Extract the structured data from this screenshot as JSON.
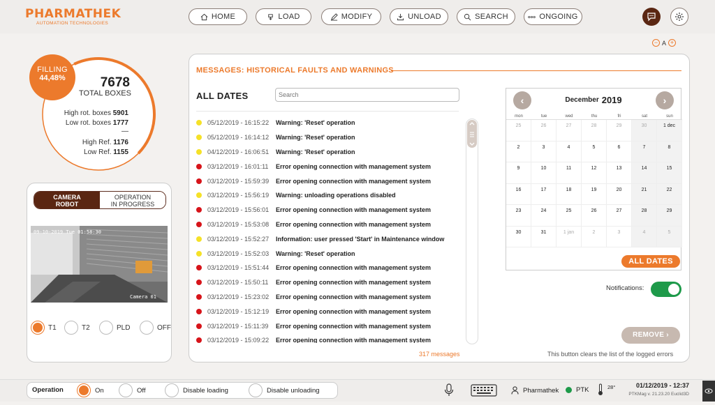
{
  "brand": {
    "name": "PHARMATHEK",
    "tagline": "AUTOMATION TECHNOLOGIES"
  },
  "nav": [
    {
      "label": "HOME",
      "icon": "home-icon"
    },
    {
      "label": "LOAD",
      "icon": "load-icon"
    },
    {
      "label": "MODIFY",
      "icon": "edit-icon"
    },
    {
      "label": "UNLOAD",
      "icon": "download-icon"
    },
    {
      "label": "SEARCH",
      "icon": "search-icon"
    },
    {
      "label": "ONGOING",
      "icon": "dots-icon"
    }
  ],
  "zoom": {
    "minus": "−",
    "label": "A",
    "plus": "+"
  },
  "filling": {
    "label": "FILLING",
    "value": "44,48%",
    "progress": 0.4448
  },
  "boxes": {
    "total": "7678",
    "total_label": "TOTAL BOXES",
    "high_rot_label": "High rot. boxes",
    "high_rot": "5901",
    "low_rot_label": "Low rot. boxes",
    "low_rot": "1777",
    "dash": "—",
    "high_ref_label": "High Ref.",
    "high_ref": "1176",
    "low_ref_label": "Low Ref.",
    "low_ref": "1155"
  },
  "camera_tabs": {
    "active_1": "CAMERA",
    "active_2": "ROBOT",
    "inactive_1": "OPERATION",
    "inactive_2": "IN PROGRESS"
  },
  "camera": {
    "timestamp": "09-10-2019 Tue 01:58:30",
    "label": "Camera 01"
  },
  "camera_options": [
    {
      "label": "T1",
      "selected": true
    },
    {
      "label": "T2",
      "selected": false
    },
    {
      "label": "PLD",
      "selected": false
    },
    {
      "label": "OFF",
      "selected": false
    }
  ],
  "messages": {
    "title": "MESSAGES: HISTORICAL FAULTS AND WARNINGS",
    "filter_label": "ALL DATES",
    "search_placeholder": "Search",
    "count": "317 messages",
    "clear_info": "This button clears the list of the logged errors",
    "items": [
      {
        "level": "warning",
        "datetime": "05/12/2019 - 16:15:22",
        "text": "Warning: 'Reset' operation"
      },
      {
        "level": "warning",
        "datetime": "05/12/2019 - 16:14:12",
        "text": "Warning: 'Reset' operation"
      },
      {
        "level": "warning",
        "datetime": "04/12/2019 - 16:06:51",
        "text": "Warning: 'Reset' operation"
      },
      {
        "level": "error",
        "datetime": "03/12/2019 - 16:01:11",
        "text": "Error opening connection with management system"
      },
      {
        "level": "error",
        "datetime": "03/12/2019 - 15:59:39",
        "text": "Error opening connection with management system"
      },
      {
        "level": "warning",
        "datetime": "03/12/2019 - 15:56:19",
        "text": "Warning: unloading operations disabled"
      },
      {
        "level": "error",
        "datetime": "03/12/2019 - 15:56:01",
        "text": "Error opening connection with management system"
      },
      {
        "level": "error",
        "datetime": "03/12/2019 - 15:53:08",
        "text": "Error opening connection with management system"
      },
      {
        "level": "warning",
        "datetime": "03/12/2019 - 15:52:27",
        "text": "Information: user pressed 'Start' in Maintenance window"
      },
      {
        "level": "warning",
        "datetime": "03/12/2019 - 15:52:03",
        "text": "Warning: 'Reset' operation"
      },
      {
        "level": "error",
        "datetime": "03/12/2019 - 15:51:44",
        "text": "Error opening connection with management system"
      },
      {
        "level": "error",
        "datetime": "03/12/2019 - 15:50:11",
        "text": "Error opening connection with management system"
      },
      {
        "level": "error",
        "datetime": "03/12/2019 - 15:23:02",
        "text": "Error opening connection with management system"
      },
      {
        "level": "error",
        "datetime": "03/12/2019 - 15:12:19",
        "text": "Error opening connection with management system"
      },
      {
        "level": "error",
        "datetime": "03/12/2019 - 15:11:39",
        "text": "Error opening connection with management system"
      },
      {
        "level": "error",
        "datetime": "03/12/2019 - 15:09:22",
        "text": "Error opening connection with management system"
      }
    ]
  },
  "calendar": {
    "month": "December",
    "year": "2019",
    "weekdays": [
      "mon",
      "tue",
      "wed",
      "thu",
      "fri",
      "sat",
      "sun"
    ],
    "weeks": [
      [
        "25",
        "26",
        "27",
        "28",
        "29",
        "30",
        "1 dec"
      ],
      [
        "2",
        "3",
        "4",
        "5",
        "6",
        "7",
        "8"
      ],
      [
        "9",
        "10",
        "11",
        "12",
        "13",
        "14",
        "15"
      ],
      [
        "16",
        "17",
        "18",
        "19",
        "20",
        "21",
        "22"
      ],
      [
        "23",
        "24",
        "25",
        "26",
        "27",
        "28",
        "29"
      ],
      [
        "30",
        "31",
        "1 jan",
        "2",
        "3",
        "4",
        "5"
      ]
    ],
    "button": "ALL DATES"
  },
  "notifications": {
    "label": "Notifications:",
    "enabled": true
  },
  "remove_label": "REMOVE",
  "footer": {
    "operation_label": "Operation",
    "options": [
      {
        "label": "On",
        "selected": true
      },
      {
        "label": "Off",
        "selected": false
      },
      {
        "label": "Disable loading",
        "selected": false
      },
      {
        "label": "Disable unloading",
        "selected": false
      }
    ],
    "user": "Pharmathek",
    "status": "PTK",
    "temperature": "28°",
    "datetime": "01/12/2019 - 12:37",
    "version": "PTKMag v. 21.23.20 Euclid3D",
    "colors": {
      "accent": "#ec7a2c",
      "error": "#d7141a",
      "warning": "#f5e128",
      "ok": "#1e9a4a"
    }
  }
}
